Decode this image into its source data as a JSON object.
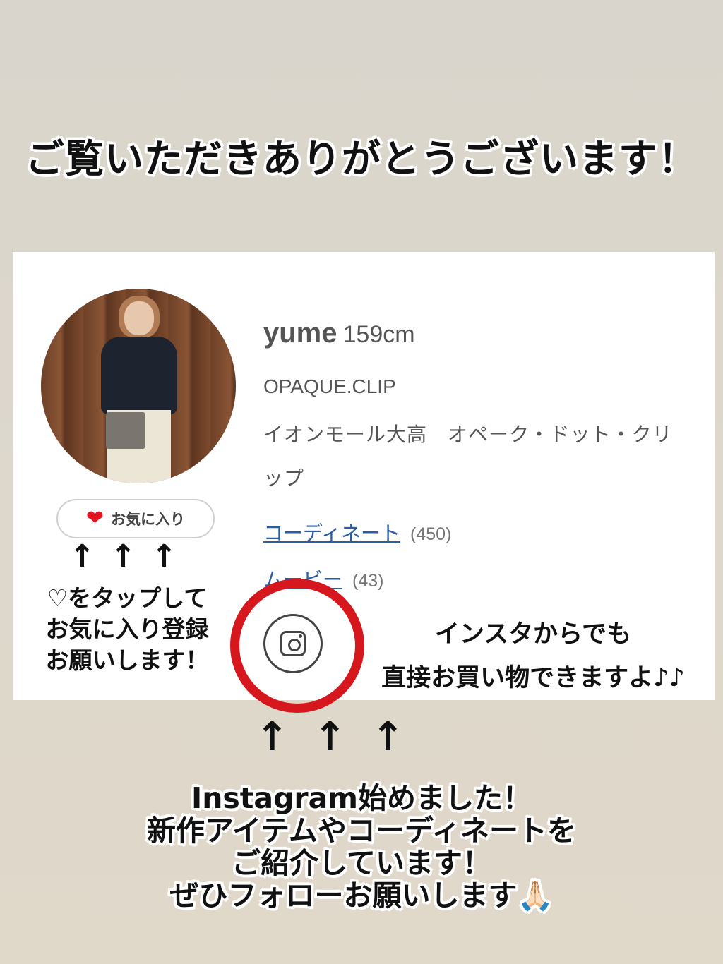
{
  "headline": "ご覧いただきありがとうございます！",
  "profile": {
    "name": "yume",
    "height": "159cm",
    "shop": "OPAQUE.CLIP",
    "location": "イオンモール大高　オペーク・ドット・クリップ",
    "links": [
      {
        "label": "コーディネート",
        "count": "(450)"
      },
      {
        "label": "ムービー",
        "count": "(43)"
      }
    ],
    "favorite_label": "お気に入り"
  },
  "notes": {
    "favorite_lines": [
      "♡をタップして",
      "お気に入り登録",
      "お願いします！"
    ],
    "insta_lines": [
      "インスタからでも",
      "直接お買い物できますよ♪♪"
    ],
    "bottom_lines": [
      "Instagram始めました！",
      "新作アイテムやコーディネートを",
      "ご紹介しています！",
      "ぜひフォローお願いします🙏🏻"
    ]
  },
  "arrow_glyph": "↑",
  "colors": {
    "accent_red": "#d6171d",
    "link_blue": "#2a5da8",
    "heart": "#e3141f"
  },
  "icons": [
    "heart-icon",
    "instagram-icon",
    "arrow-up-icon"
  ]
}
